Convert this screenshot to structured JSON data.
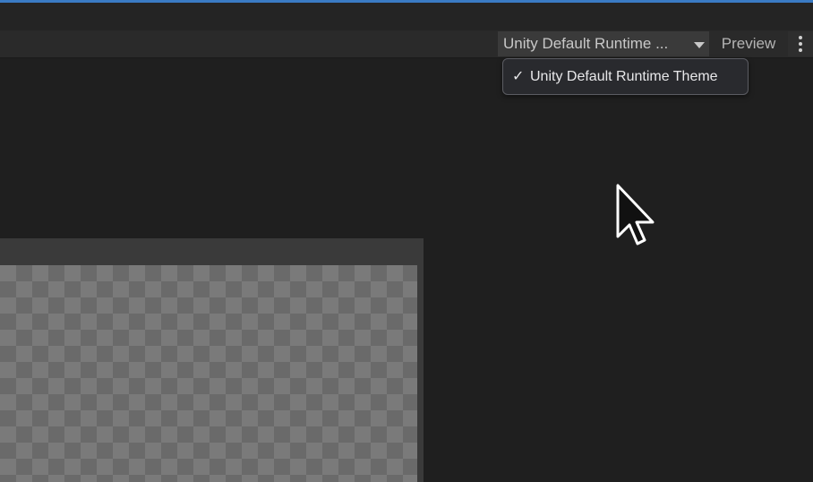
{
  "toolbar": {
    "theme_dropdown_label": "Unity Default Runtime ...",
    "preview_label": "Preview",
    "more_icon": "kebab-menu-icon"
  },
  "theme_menu": {
    "items": [
      {
        "check": "✓",
        "label": "Unity Default Runtime Theme",
        "selected": true
      }
    ]
  },
  "colors": {
    "accent": "#3a7bc4",
    "background": "#1f1f1f",
    "toolbar": "#2a2a2a",
    "dropdown": "#3a3a3a"
  }
}
